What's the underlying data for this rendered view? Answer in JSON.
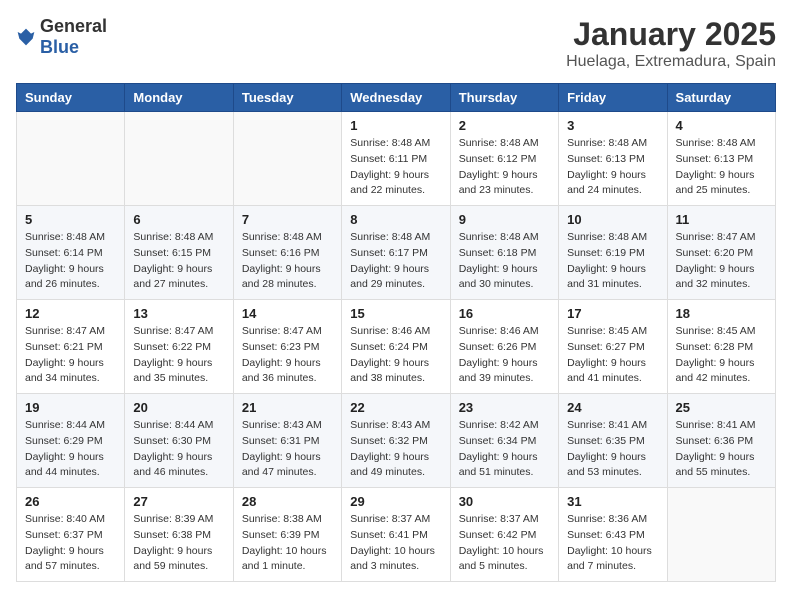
{
  "header": {
    "logo_general": "General",
    "logo_blue": "Blue",
    "month_title": "January 2025",
    "location": "Huelaga, Extremadura, Spain"
  },
  "weekdays": [
    "Sunday",
    "Monday",
    "Tuesday",
    "Wednesday",
    "Thursday",
    "Friday",
    "Saturday"
  ],
  "weeks": [
    [
      {
        "day": "",
        "sunrise": "",
        "sunset": "",
        "daylight": ""
      },
      {
        "day": "",
        "sunrise": "",
        "sunset": "",
        "daylight": ""
      },
      {
        "day": "",
        "sunrise": "",
        "sunset": "",
        "daylight": ""
      },
      {
        "day": "1",
        "sunrise": "Sunrise: 8:48 AM",
        "sunset": "Sunset: 6:11 PM",
        "daylight": "Daylight: 9 hours and 22 minutes."
      },
      {
        "day": "2",
        "sunrise": "Sunrise: 8:48 AM",
        "sunset": "Sunset: 6:12 PM",
        "daylight": "Daylight: 9 hours and 23 minutes."
      },
      {
        "day": "3",
        "sunrise": "Sunrise: 8:48 AM",
        "sunset": "Sunset: 6:13 PM",
        "daylight": "Daylight: 9 hours and 24 minutes."
      },
      {
        "day": "4",
        "sunrise": "Sunrise: 8:48 AM",
        "sunset": "Sunset: 6:13 PM",
        "daylight": "Daylight: 9 hours and 25 minutes."
      }
    ],
    [
      {
        "day": "5",
        "sunrise": "Sunrise: 8:48 AM",
        "sunset": "Sunset: 6:14 PM",
        "daylight": "Daylight: 9 hours and 26 minutes."
      },
      {
        "day": "6",
        "sunrise": "Sunrise: 8:48 AM",
        "sunset": "Sunset: 6:15 PM",
        "daylight": "Daylight: 9 hours and 27 minutes."
      },
      {
        "day": "7",
        "sunrise": "Sunrise: 8:48 AM",
        "sunset": "Sunset: 6:16 PM",
        "daylight": "Daylight: 9 hours and 28 minutes."
      },
      {
        "day": "8",
        "sunrise": "Sunrise: 8:48 AM",
        "sunset": "Sunset: 6:17 PM",
        "daylight": "Daylight: 9 hours and 29 minutes."
      },
      {
        "day": "9",
        "sunrise": "Sunrise: 8:48 AM",
        "sunset": "Sunset: 6:18 PM",
        "daylight": "Daylight: 9 hours and 30 minutes."
      },
      {
        "day": "10",
        "sunrise": "Sunrise: 8:48 AM",
        "sunset": "Sunset: 6:19 PM",
        "daylight": "Daylight: 9 hours and 31 minutes."
      },
      {
        "day": "11",
        "sunrise": "Sunrise: 8:47 AM",
        "sunset": "Sunset: 6:20 PM",
        "daylight": "Daylight: 9 hours and 32 minutes."
      }
    ],
    [
      {
        "day": "12",
        "sunrise": "Sunrise: 8:47 AM",
        "sunset": "Sunset: 6:21 PM",
        "daylight": "Daylight: 9 hours and 34 minutes."
      },
      {
        "day": "13",
        "sunrise": "Sunrise: 8:47 AM",
        "sunset": "Sunset: 6:22 PM",
        "daylight": "Daylight: 9 hours and 35 minutes."
      },
      {
        "day": "14",
        "sunrise": "Sunrise: 8:47 AM",
        "sunset": "Sunset: 6:23 PM",
        "daylight": "Daylight: 9 hours and 36 minutes."
      },
      {
        "day": "15",
        "sunrise": "Sunrise: 8:46 AM",
        "sunset": "Sunset: 6:24 PM",
        "daylight": "Daylight: 9 hours and 38 minutes."
      },
      {
        "day": "16",
        "sunrise": "Sunrise: 8:46 AM",
        "sunset": "Sunset: 6:26 PM",
        "daylight": "Daylight: 9 hours and 39 minutes."
      },
      {
        "day": "17",
        "sunrise": "Sunrise: 8:45 AM",
        "sunset": "Sunset: 6:27 PM",
        "daylight": "Daylight: 9 hours and 41 minutes."
      },
      {
        "day": "18",
        "sunrise": "Sunrise: 8:45 AM",
        "sunset": "Sunset: 6:28 PM",
        "daylight": "Daylight: 9 hours and 42 minutes."
      }
    ],
    [
      {
        "day": "19",
        "sunrise": "Sunrise: 8:44 AM",
        "sunset": "Sunset: 6:29 PM",
        "daylight": "Daylight: 9 hours and 44 minutes."
      },
      {
        "day": "20",
        "sunrise": "Sunrise: 8:44 AM",
        "sunset": "Sunset: 6:30 PM",
        "daylight": "Daylight: 9 hours and 46 minutes."
      },
      {
        "day": "21",
        "sunrise": "Sunrise: 8:43 AM",
        "sunset": "Sunset: 6:31 PM",
        "daylight": "Daylight: 9 hours and 47 minutes."
      },
      {
        "day": "22",
        "sunrise": "Sunrise: 8:43 AM",
        "sunset": "Sunset: 6:32 PM",
        "daylight": "Daylight: 9 hours and 49 minutes."
      },
      {
        "day": "23",
        "sunrise": "Sunrise: 8:42 AM",
        "sunset": "Sunset: 6:34 PM",
        "daylight": "Daylight: 9 hours and 51 minutes."
      },
      {
        "day": "24",
        "sunrise": "Sunrise: 8:41 AM",
        "sunset": "Sunset: 6:35 PM",
        "daylight": "Daylight: 9 hours and 53 minutes."
      },
      {
        "day": "25",
        "sunrise": "Sunrise: 8:41 AM",
        "sunset": "Sunset: 6:36 PM",
        "daylight": "Daylight: 9 hours and 55 minutes."
      }
    ],
    [
      {
        "day": "26",
        "sunrise": "Sunrise: 8:40 AM",
        "sunset": "Sunset: 6:37 PM",
        "daylight": "Daylight: 9 hours and 57 minutes."
      },
      {
        "day": "27",
        "sunrise": "Sunrise: 8:39 AM",
        "sunset": "Sunset: 6:38 PM",
        "daylight": "Daylight: 9 hours and 59 minutes."
      },
      {
        "day": "28",
        "sunrise": "Sunrise: 8:38 AM",
        "sunset": "Sunset: 6:39 PM",
        "daylight": "Daylight: 10 hours and 1 minute."
      },
      {
        "day": "29",
        "sunrise": "Sunrise: 8:37 AM",
        "sunset": "Sunset: 6:41 PM",
        "daylight": "Daylight: 10 hours and 3 minutes."
      },
      {
        "day": "30",
        "sunrise": "Sunrise: 8:37 AM",
        "sunset": "Sunset: 6:42 PM",
        "daylight": "Daylight: 10 hours and 5 minutes."
      },
      {
        "day": "31",
        "sunrise": "Sunrise: 8:36 AM",
        "sunset": "Sunset: 6:43 PM",
        "daylight": "Daylight: 10 hours and 7 minutes."
      },
      {
        "day": "",
        "sunrise": "",
        "sunset": "",
        "daylight": ""
      }
    ]
  ]
}
